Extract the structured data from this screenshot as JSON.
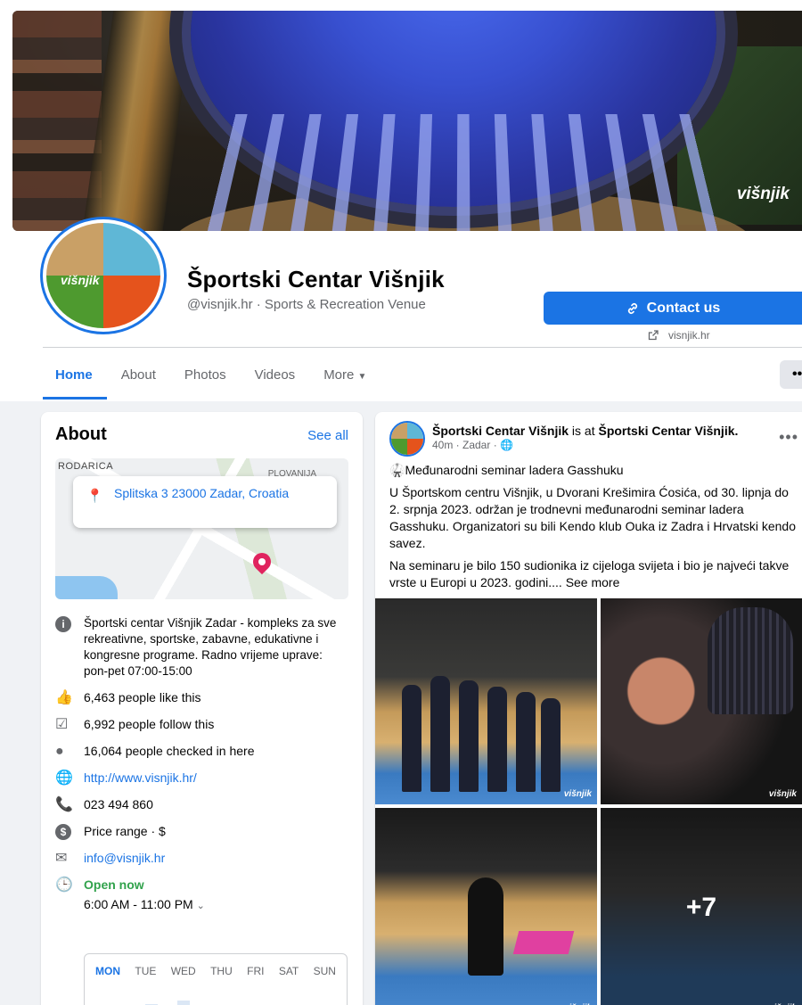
{
  "cover": {
    "logo_text": "višnjik"
  },
  "profile": {
    "name": "Športski Centar Višnjik",
    "subtitle": "@visnjik.hr · Sports & Recreation Venue",
    "avatar_text": "višnjik"
  },
  "actions": {
    "contact_label": "Contact us",
    "website_label": "visnjik.hr"
  },
  "tabs": [
    "Home",
    "About",
    "Photos",
    "Videos",
    "More"
  ],
  "tab_more_icon": "•••",
  "about": {
    "title": "About",
    "see_all": "See all",
    "map_area_label": "RODARICA",
    "map_area_label2": "PLOVANIJA",
    "address": "Splitska 3 23000 Zadar, Croatia",
    "description": "Športski centar Višnjik Zadar - kompleks za sve rekreativne, sportske, zabavne, edukativne i kongresne programe. Radno vrijeme uprave: pon-pet 07:00-15:00",
    "likes": "6,463 people like this",
    "follows": "6,992 people follow this",
    "checkins": "16,064 people checked in here",
    "website": "http://www.visnjik.hr/",
    "phone": "023 494 860",
    "price": "Price range · $",
    "email": "info@visnjik.hr",
    "open_now": "Open now",
    "hours": "6:00 AM - 11:00 PM",
    "days": [
      "MON",
      "TUE",
      "WED",
      "THU",
      "FRI",
      "SAT",
      "SUN"
    ],
    "active_day": "MON"
  },
  "post": {
    "author": "Športski Centar Višnjik",
    "is_at": "is at",
    "location": "Športski Centar Višnjik.",
    "meta": "40m · Zadar ·",
    "headline": "Međunarodni seminar ladera Gasshuku",
    "para1": "U Športskom centru Višnjik, u Dvorani Krešimira Ćosića, od 30. lipnja do 2. srpnja 2023. održan je trodnevni međunarodni seminar ladera Gasshuku. Organizatori su bili Kendo klub Ouka iz Zadra i Hrvatski kendo savez.",
    "para2": "Na seminaru je bilo 150 sudionika iz cijeloga svijeta i bio je najveći takve vrste u Europi u 2023. godini....",
    "see_more": "See more",
    "more_photos": "+7",
    "watermark": "višnjik"
  },
  "colors": {
    "accent": "#1b74e4",
    "open": "#31a24c",
    "pin": "#e0245e"
  }
}
